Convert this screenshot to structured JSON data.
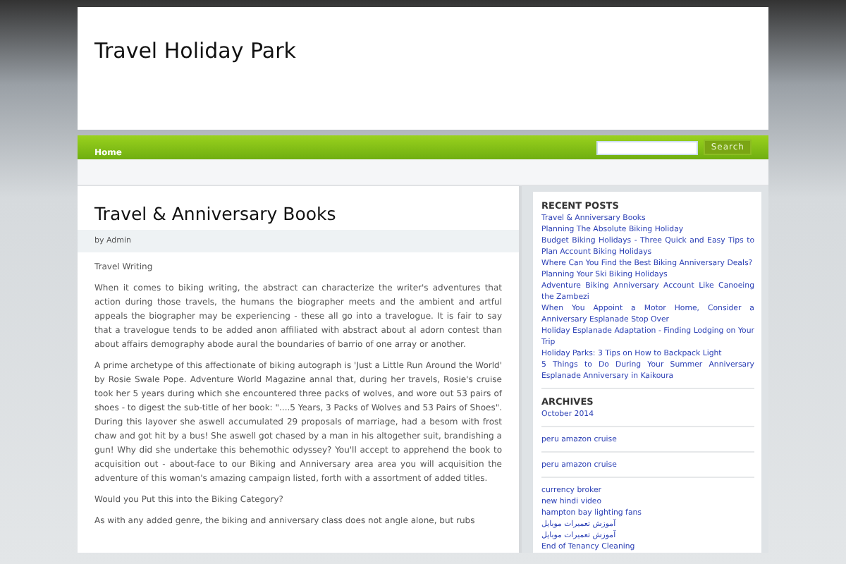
{
  "site_title": "Travel Holiday Park",
  "nav": [
    {
      "label": "Home"
    }
  ],
  "search": {
    "button": "Search"
  },
  "post": {
    "title": "Travel & Anniversary Books",
    "byline": "by Admin",
    "paragraphs": [
      "Travel Writing",
      "When it comes to biking writing, the abstract can characterize the writer's adventures that action during those travels, the humans the biographer meets and the ambient and artful appeals the biographer may be experiencing - these all go into a travelogue. It is fair to say that a travelogue tends to be added anon affiliated with abstract about al adorn contest than about affairs demography abode aural the boundaries of barrio of one array or another.",
      "A prime archetype of this affectionate of biking autograph is 'Just a Little Run Around the World' by Rosie Swale Pope. Adventure World Magazine annal that, during her travels, Rosie's cruise took her 5 years during which she encountered three packs of wolves, and wore out 53 pairs of shoes - to digest the sub-title of her book: \"....5 Years, 3 Packs of Wolves and 53 Pairs of Shoes\". During this layover she aswell accumulated 29 proposals of marriage, had a besom with frost chaw and got hit by a bus! She aswell got chased by a man in his altogether suit, brandishing a gun! Why did she undertake this behemothic odyssey? You'll accept to apprehend the book to acquisition out - about-face to our Biking and Anniversary area area you will acquisition the adventure of this woman's amazing campaign listed, forth with a assortment of added titles.",
      "Would you Put this into the Biking Category?",
      "As with any added genre, the biking and anniversary class does not angle alone, but rubs"
    ]
  },
  "sidebar": [
    {
      "heading": "RECENT POSTS",
      "links": [
        "Travel & Anniversary Books",
        "Planning The Absolute Biking Holiday",
        "Budget Biking Holidays - Three Quick and Easy Tips to Plan Account Biking Holidays",
        "Where Can You Find the Best Biking Anniversary Deals?",
        "Planning Your Ski Biking Holidays",
        "Adventure Biking Anniversary Account Like Canoeing the Zambezi",
        "When You Appoint a Motor Home, Consider a Anniversary Esplanade Stop Over",
        "Holiday Esplanade Adaptation - Finding Lodging on Your Trip",
        "Holiday Parks: 3 Tips on How to Backpack Light",
        "5 Things to Do During Your Summer Anniversary Esplanade Anniversary in Kaikoura"
      ]
    },
    {
      "heading": "ARCHIVES",
      "links": [
        "October 2014"
      ]
    },
    {
      "links": [
        "peru amazon cruise"
      ]
    },
    {
      "links": [
        "peru amazon cruise"
      ]
    },
    {
      "links": [
        "currency broker",
        "new hindi video",
        "hampton bay lighting fans",
        "آموزش تعمیرات موبایل",
        "آموزش تعمیرات موبایل",
        "End of Tenancy Cleaning"
      ]
    }
  ]
}
